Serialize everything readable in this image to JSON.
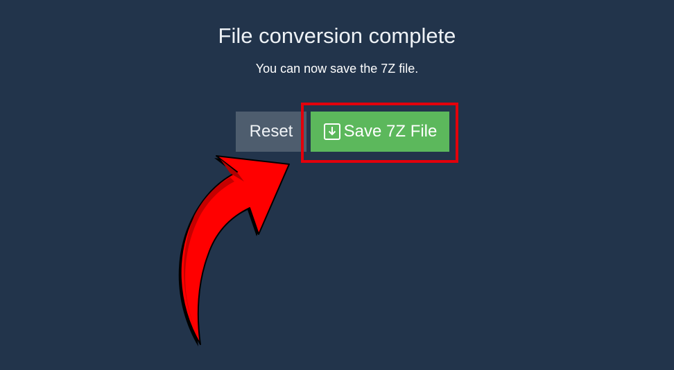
{
  "dialog": {
    "title": "File conversion complete",
    "subtitle": "You can now save the 7Z file."
  },
  "buttons": {
    "reset_label": "Reset",
    "save_label": "Save 7Z File",
    "save_icon": "download-box-icon"
  },
  "annotation": {
    "highlight_color": "#e3000b",
    "arrow_color": "#ff0000",
    "arrow_icon": "curved-arrow-pointer-icon"
  },
  "colors": {
    "background": "#22344b",
    "reset_button": "#4e5d6e",
    "save_button": "#5cb85c"
  }
}
